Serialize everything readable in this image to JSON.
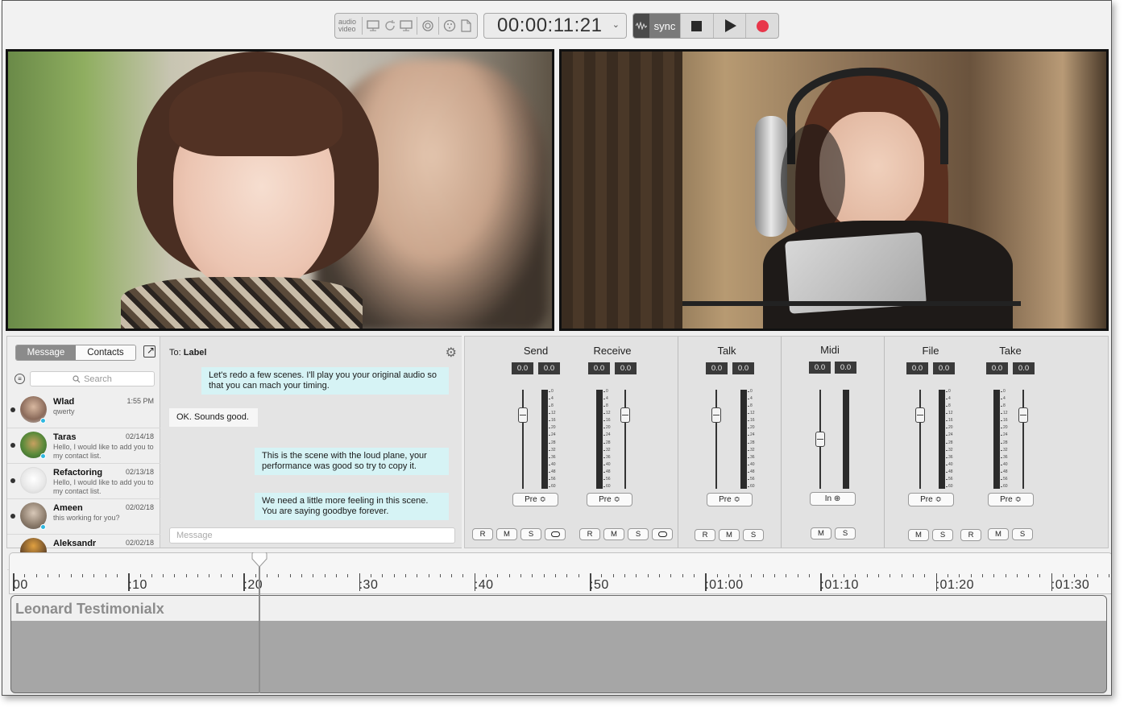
{
  "toolbar": {
    "av_label_top": "audio",
    "av_label_bottom": "video",
    "timecode": "00:00:11:21",
    "sync_label": "sync",
    "icons": [
      "monitor-icon",
      "refresh-icon",
      "display-icon",
      "clock-icon",
      "meter-icon",
      "file-icon"
    ]
  },
  "messenger": {
    "tabs": {
      "message": "Message",
      "contacts": "Contacts"
    },
    "search_placeholder": "Search",
    "to_prefix": "To:",
    "to_name": "Label",
    "contacts": [
      {
        "name": "Wlad",
        "date": "1:55 PM",
        "preview": "qwerty",
        "online": true
      },
      {
        "name": "Taras",
        "date": "02/14/18",
        "preview": "Hello, I would like to add you to my contact list.",
        "online": true
      },
      {
        "name": "Refactoring",
        "date": "02/13/18",
        "preview": "Hello, I would like to add you to my contact list.",
        "online": false
      },
      {
        "name": "Ameen",
        "date": "02/02/18",
        "preview": "this working for you?",
        "online": true
      },
      {
        "name": "Aleksandr",
        "date": "02/02/18",
        "preview": "",
        "online": false
      }
    ],
    "messages": [
      {
        "dir": "out",
        "text": "Let's redo a few scenes. I'll play you your original audio so that you can mach your timing."
      },
      {
        "dir": "in",
        "text": "OK. Sounds good."
      },
      {
        "dir": "out",
        "text": "This is the scene with the loud plane, your performance was good so try to copy it."
      },
      {
        "dir": "out",
        "text": "We need a little more feeling in this scene. You are saying goodbye forever."
      }
    ],
    "input_placeholder": "Message"
  },
  "mixer": {
    "scale": [
      "0",
      "4",
      "8",
      "12",
      "16",
      "20",
      "24",
      "28",
      "32",
      "36",
      "40",
      "48",
      "56",
      "60"
    ],
    "channels": {
      "send": {
        "title": "Send",
        "v1": "0.0",
        "v2": "0.0",
        "pill": "Pre ≎"
      },
      "receive": {
        "title": "Receive",
        "v1": "0.0",
        "v2": "0.0",
        "pill": "Pre ≎"
      },
      "talk": {
        "title": "Talk",
        "v1": "0.0",
        "v2": "0.0",
        "pill": "Pre ≎"
      },
      "midi": {
        "title": "Midi",
        "v1": "0.0",
        "v2": "0.0",
        "pill": "In ⊕"
      },
      "file": {
        "title": "File",
        "v1": "0.0",
        "v2": "0.0",
        "pill": "Pre ≎"
      },
      "take": {
        "title": "Take",
        "v1": "0.0",
        "v2": "0.0",
        "pill": "Pre ≎"
      }
    },
    "buttons": {
      "r": "R",
      "m": "M",
      "s": "S"
    }
  },
  "timeline": {
    "labels": [
      "00",
      ":10",
      ":20",
      ":30",
      ":40",
      ":50",
      ":01:00",
      ":01:10",
      ":01:20",
      ":01:30"
    ],
    "track_title": "Leonard Testimonialx",
    "playhead_time": ":21"
  }
}
